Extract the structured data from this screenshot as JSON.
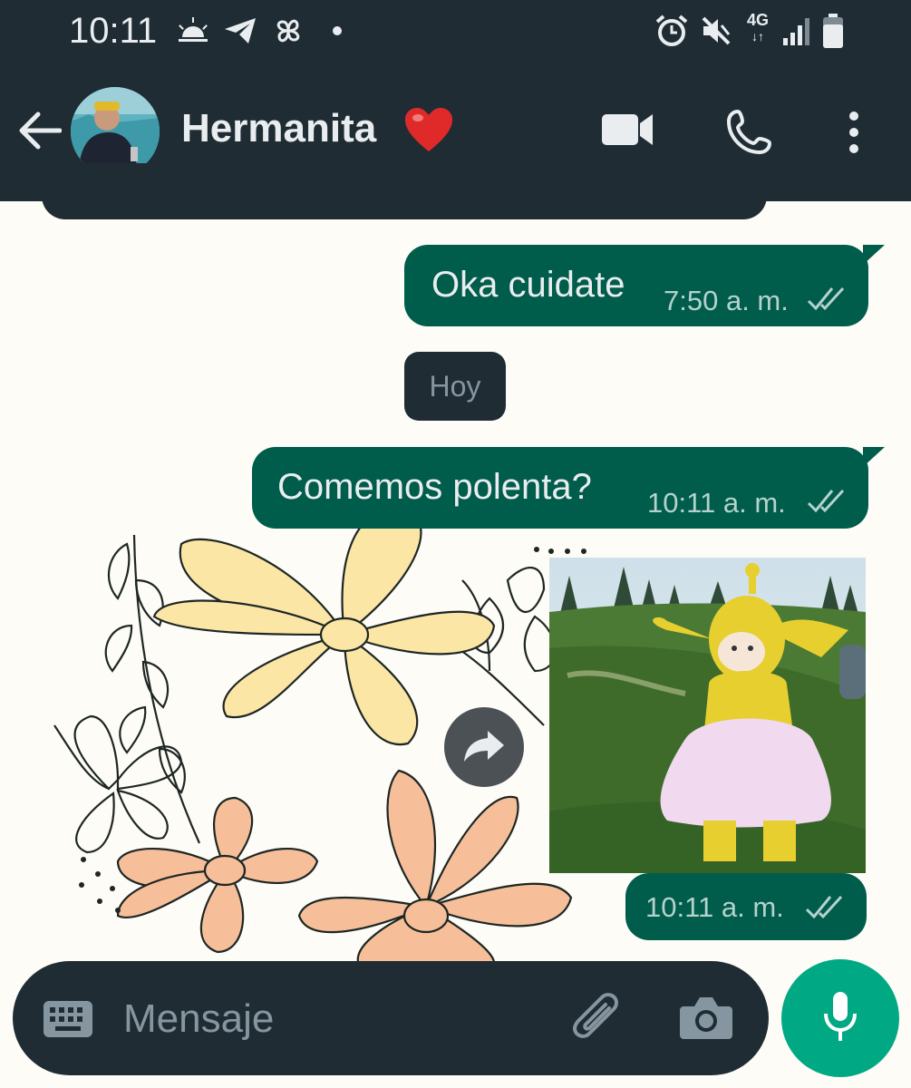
{
  "status_bar": {
    "time": "10:11",
    "network_label": "4G"
  },
  "header": {
    "contact_name": "Hermanita",
    "contact_emoji": "❤️"
  },
  "messages": [
    {
      "direction": "outgoing",
      "text": "Oka cuidate",
      "time": "7:50 a. m.",
      "status": "read"
    },
    {
      "direction": "outgoing",
      "text": "Comemos polenta?",
      "time": "10:11 a. m.",
      "status": "read"
    },
    {
      "direction": "outgoing",
      "type": "gif",
      "time": "10:11 a. m.",
      "status": "read"
    }
  ],
  "date_divider": "Hoy",
  "composer": {
    "placeholder": "Mensaje"
  },
  "colors": {
    "header_bg": "#1f2c34",
    "outgoing_bubble": "#005c4b",
    "accent": "#00a884",
    "tick_color": "#b5d2cc"
  },
  "icons": [
    "back-arrow-icon",
    "video-call-icon",
    "voice-call-icon",
    "more-options-icon",
    "keyboard-icon",
    "attach-icon",
    "camera-icon",
    "mic-icon",
    "forward-icon"
  ]
}
